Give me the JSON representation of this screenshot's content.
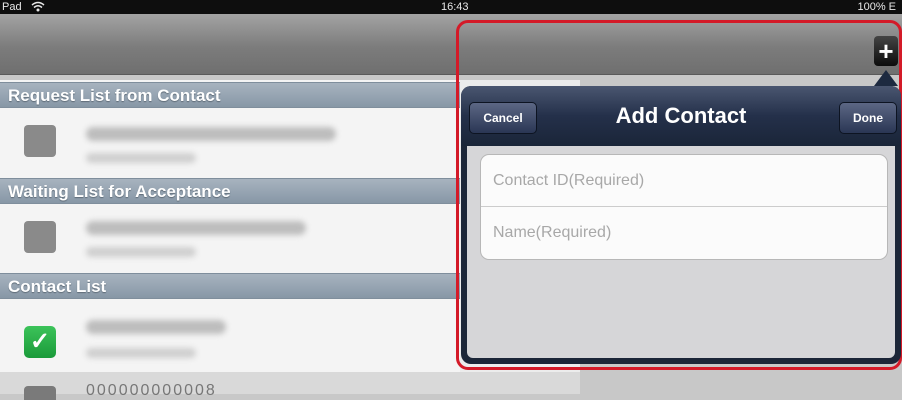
{
  "status": {
    "carrier": "Pad",
    "wifi_icon": "wifi-icon",
    "time": "16:43",
    "battery": "100% E"
  },
  "nav": {
    "add_label": "+",
    "add_icon": "plus-icon"
  },
  "sections": {
    "request": {
      "header": "Request List from Contact"
    },
    "waiting": {
      "header": "Waiting List for Acceptance"
    },
    "contacts": {
      "header": "Contact List"
    }
  },
  "bottom_row": {
    "text": "000000000008"
  },
  "popover": {
    "title": "Add Contact",
    "cancel_label": "Cancel",
    "done_label": "Done",
    "contact_id_placeholder": "Contact ID(Required)",
    "name_placeholder": "Name(Required)"
  },
  "colors": {
    "highlight_border": "#d41a28",
    "section_header": "#8797a6",
    "checkbox": "#1a9a3a"
  }
}
